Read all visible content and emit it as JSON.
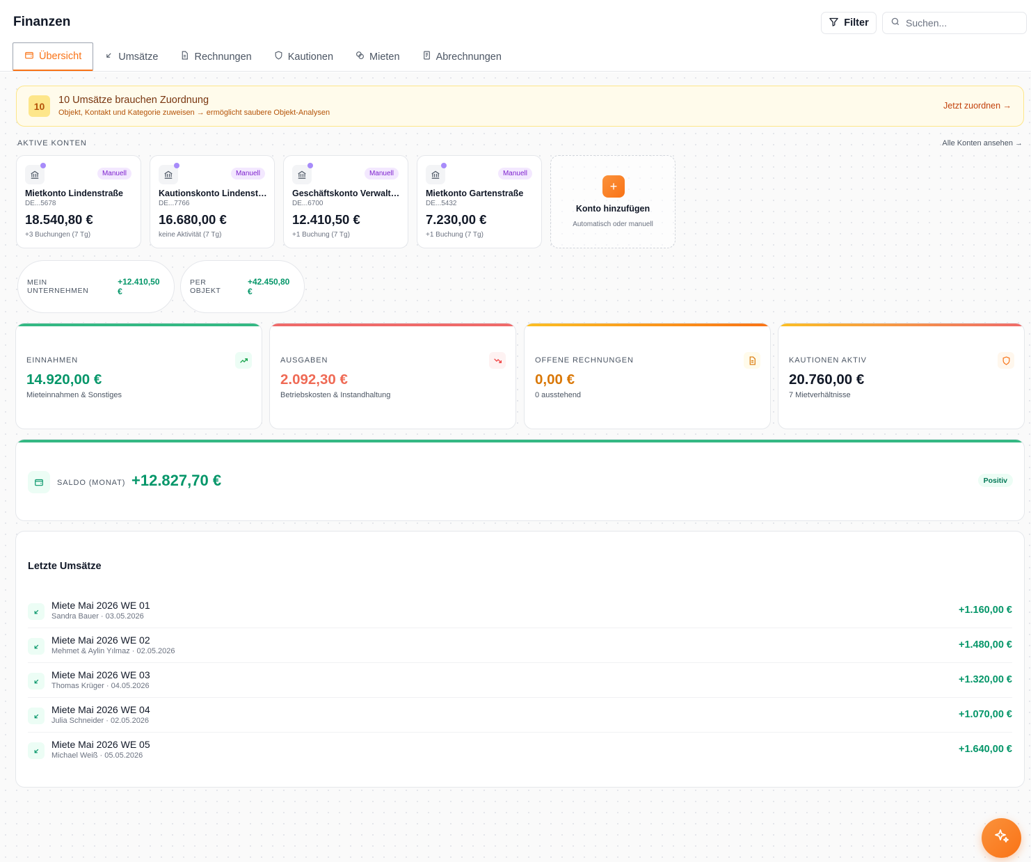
{
  "header": {
    "title": "Finanzen",
    "filter_label": "Filter",
    "search_placeholder": "Suchen..."
  },
  "tabs": [
    {
      "label": "Übersicht",
      "icon": "wallet-icon",
      "active": true
    },
    {
      "label": "Umsätze",
      "icon": "arrow-down-left-icon"
    },
    {
      "label": "Rechnungen",
      "icon": "file-text-icon"
    },
    {
      "label": "Kautionen",
      "icon": "shield-icon"
    },
    {
      "label": "Mieten",
      "icon": "coins-icon"
    },
    {
      "label": "Abrechnungen",
      "icon": "receipt-icon"
    }
  ],
  "alert": {
    "count": "10",
    "title": "10 Umsätze brauchen Zuordnung",
    "subtitle": "Objekt, Kontakt und Kategorie zuweisen → ermöglicht saubere Objekt-Analysen",
    "action": "Jetzt zuordnen →"
  },
  "accounts_section": {
    "label": "AKTIVE KONTEN",
    "link": "Alle Konten ansehen →"
  },
  "accounts": [
    {
      "name": "Mietkonto Lindenstraße",
      "iban": "DE...5678",
      "balance": "18.540,80 €",
      "note": "+3 Buchungen (7 Tg)",
      "badge": "Manuell",
      "icon": "bank-icon"
    },
    {
      "name": "Kautionskonto Lindenstraße",
      "iban": "DE...7766",
      "balance": "16.680,00 €",
      "note": "keine Aktivität (7 Tg)",
      "badge": "Manuell",
      "icon": "bank-icon"
    },
    {
      "name": "Geschäftskonto Verwaltung",
      "iban": "DE...6700",
      "balance": "12.410,50 €",
      "note": "+1 Buchung (7 Tg)",
      "badge": "Manuell",
      "icon": "bank-icon"
    },
    {
      "name": "Mietkonto Gartenstraße",
      "iban": "DE...5432",
      "balance": "7.230,00 €",
      "note": "+1 Buchung (7 Tg)",
      "badge": "Manuell",
      "icon": "bank-icon"
    }
  ],
  "add_account": {
    "title": "Konto hinzufügen",
    "subtitle": "Automatisch oder manuell",
    "icon": "plus-icon"
  },
  "pills": [
    {
      "label": "MEIN UNTERNEHMEN",
      "value": "+12.410,50 €"
    },
    {
      "label": "PER OBJEKT",
      "value": "+42.450,80 €"
    }
  ],
  "stats": [
    {
      "label": "EINNAHMEN",
      "value": "14.920,00 €",
      "sub": "Mieteinnahmen & Sonstiges",
      "icon": "trending-up-icon",
      "color": "#16a34a"
    },
    {
      "label": "AUSGABEN",
      "value": "2.092,30 €",
      "sub": "Betriebskosten & Instandhaltung",
      "icon": "trending-down-icon",
      "color": "#ef6a55"
    },
    {
      "label": "OFFENE RECHNUNGEN",
      "value": "0,00 €",
      "sub": "0 ausstehend",
      "icon": "file-text-icon",
      "color": "#d97706"
    },
    {
      "label": "KAUTIONEN AKTIV",
      "value": "20.760,00 €",
      "sub": "7 Mietverhältnisse",
      "icon": "shield-icon",
      "color": "#111827"
    }
  ],
  "saldo": {
    "label": "SALDO (MONAT)",
    "value": "+12.827,70 €",
    "badge": "Positiv",
    "icon": "wallet-icon"
  },
  "transactions": {
    "title": "Letzte Umsätze",
    "items": [
      {
        "name": "Miete Mai 2026 WE 01",
        "meta": "Sandra Bauer · 03.05.2026",
        "amount": "+1.160,00 €"
      },
      {
        "name": "Miete Mai 2026 WE 02",
        "meta": "Mehmet & Aylin Yılmaz · 02.05.2026",
        "amount": "+1.480,00 €"
      },
      {
        "name": "Miete Mai 2026 WE 03",
        "meta": "Thomas Krüger · 04.05.2026",
        "amount": "+1.320,00 €"
      },
      {
        "name": "Miete Mai 2026 WE 04",
        "meta": "Julia Schneider · 02.05.2026",
        "amount": "+1.070,00 €"
      },
      {
        "name": "Miete Mai 2026 WE 05",
        "meta": "Michael Weiß · 05.05.2026",
        "amount": "+1.640,00 €"
      }
    ]
  },
  "colors": {
    "accent": "#f97316",
    "positive": "#059669",
    "negative": "#ef6a55",
    "warning": "#d97706",
    "badge_purple": "#7e22ce"
  }
}
